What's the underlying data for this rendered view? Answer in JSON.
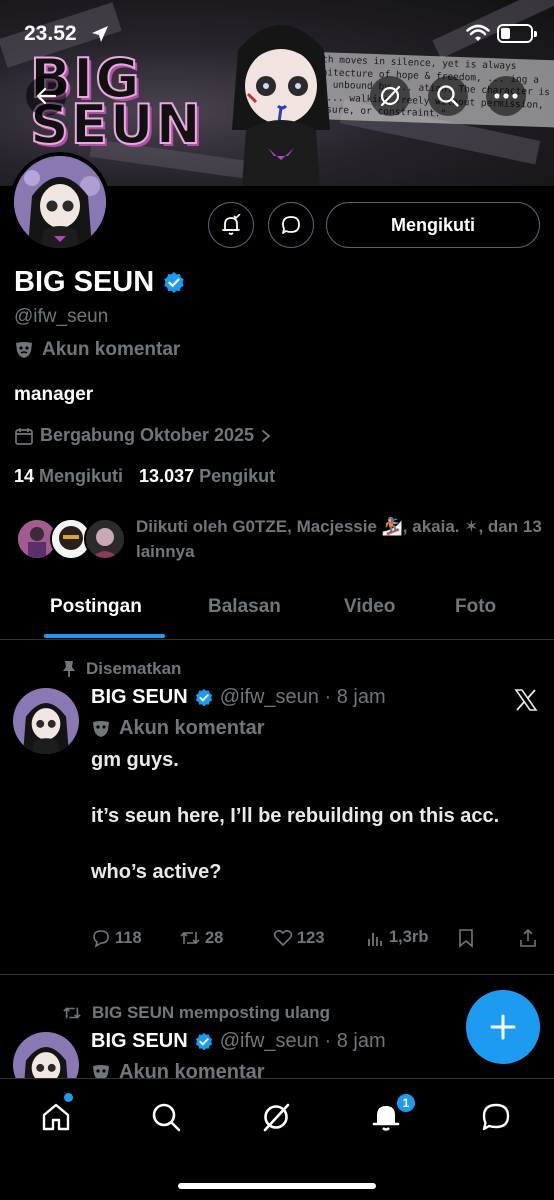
{
  "status_bar": {
    "time": "23.52"
  },
  "banner": {
    "logo_text_line1": "BIG",
    "logo_text_line2": "SEUN",
    "quote": "...th moves in silence, yet is always architecture of hope & freedom, ... ing a path unbound by ... ation. The character is the ... walking freely without permission, pressure, or constraint.\""
  },
  "profile": {
    "name": "BIG SEUN",
    "handle": "@ifw_seun",
    "label_icon": "theater-masks-icon",
    "label": "Akun komentar",
    "bio": "manager",
    "joined": "Bergabung Oktober 2025",
    "following_count": "14",
    "following_label": "Mengikuti",
    "followers_count": "13.037",
    "followers_label": "Pengikut",
    "followed_by": "Diikuti oleh G0TZE, Macjessie 🏂, akaia. ✶, dan 13 lainnya",
    "follow_button": "Mengikuti"
  },
  "tabs": [
    {
      "label": "Postingan",
      "active": true
    },
    {
      "label": "Balasan",
      "active": false
    },
    {
      "label": "Video",
      "active": false
    },
    {
      "label": "Foto",
      "active": false
    }
  ],
  "posts": [
    {
      "context": "Disematkan",
      "name": "BIG SEUN",
      "handle_time": "@ifw_seun · 8 jam",
      "label": "Akun komentar",
      "body": [
        "gm guys.",
        "it’s seun here, I’ll be rebuilding on this acc.",
        "who’s active?"
      ],
      "replies": "118",
      "reposts": "28",
      "likes": "123",
      "views": "1,3rb"
    },
    {
      "context": "BIG SEUN memposting ulang",
      "name": "BIG SEUN",
      "handle_time": "@ifw_seun · 8 jam",
      "label": "Akun komentar"
    }
  ],
  "bottom_nav": {
    "notifications_badge": "1"
  },
  "colors": {
    "accent": "#1d9bf0",
    "muted": "#71767b",
    "border": "#2f3336",
    "background": "#000000"
  }
}
